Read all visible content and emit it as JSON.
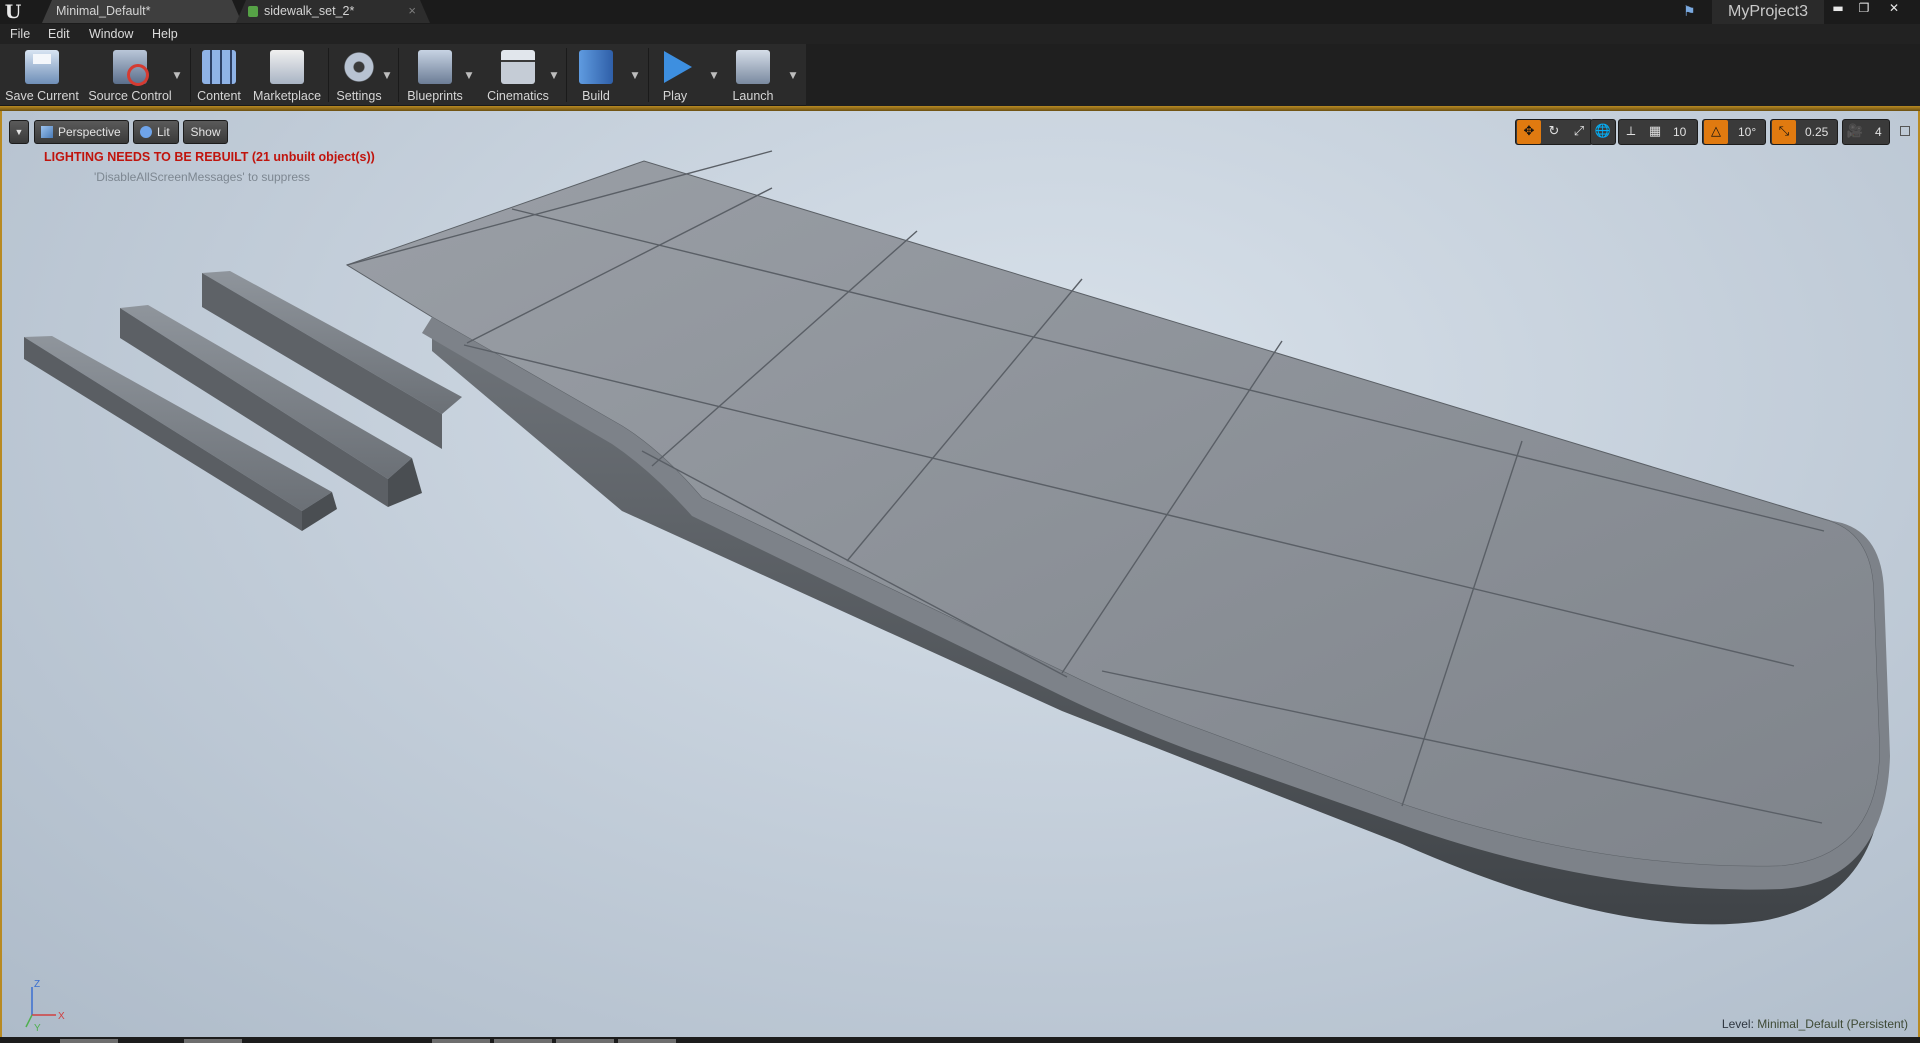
{
  "app": {
    "logo_text": "U",
    "tabs": [
      {
        "label": "Minimal_Default*",
        "active": true
      },
      {
        "label": "sidewalk_set_2*",
        "active": false
      }
    ],
    "tab_close": "×",
    "project_name": "MyProject3",
    "window_controls": {
      "minimize": "▬",
      "restore": "❐",
      "close": "✕"
    }
  },
  "menu": [
    "File",
    "Edit",
    "Window",
    "Help"
  ],
  "toolbar": {
    "buttons": [
      {
        "label": "Save Current",
        "icon": "save-icon"
      },
      {
        "label": "Source Control",
        "icon": "source-control-icon"
      },
      {
        "label": "Content",
        "icon": "content-browser-icon"
      },
      {
        "label": "Marketplace",
        "icon": "marketplace-icon"
      },
      {
        "label": "Settings",
        "icon": "settings-gear-icon"
      },
      {
        "label": "Blueprints",
        "icon": "blueprints-icon"
      },
      {
        "label": "Cinematics",
        "icon": "cinematics-clapper-icon"
      },
      {
        "label": "Build",
        "icon": "build-icon"
      },
      {
        "label": "Play",
        "icon": "play-icon"
      },
      {
        "label": "Launch",
        "icon": "launch-icon"
      }
    ],
    "dropdown_glyph": "▼"
  },
  "viewport": {
    "menu_glyph": "▼",
    "perspective_label": "Perspective",
    "lit_label": "Lit",
    "show_label": "Show",
    "warning": "LIGHTING NEEDS TO BE REBUILT (21 unbuilt object(s))",
    "warning_hint": "'DisableAllScreenMessages' to suppress",
    "right_tools": {
      "grid_snap_value": "10",
      "rotation_snap_value": "10°",
      "scale_snap_value": "0.25",
      "camera_speed_value": "4"
    },
    "axis": {
      "z": "Z",
      "x": "X",
      "y": "Y"
    },
    "level_prefix": "Level:",
    "level_name": "Minimal_Default (Persistent)"
  },
  "colors": {
    "accent_gold": "#b88a22",
    "warning_red": "#c0140d",
    "snap_active_orange": "#e07a10"
  }
}
